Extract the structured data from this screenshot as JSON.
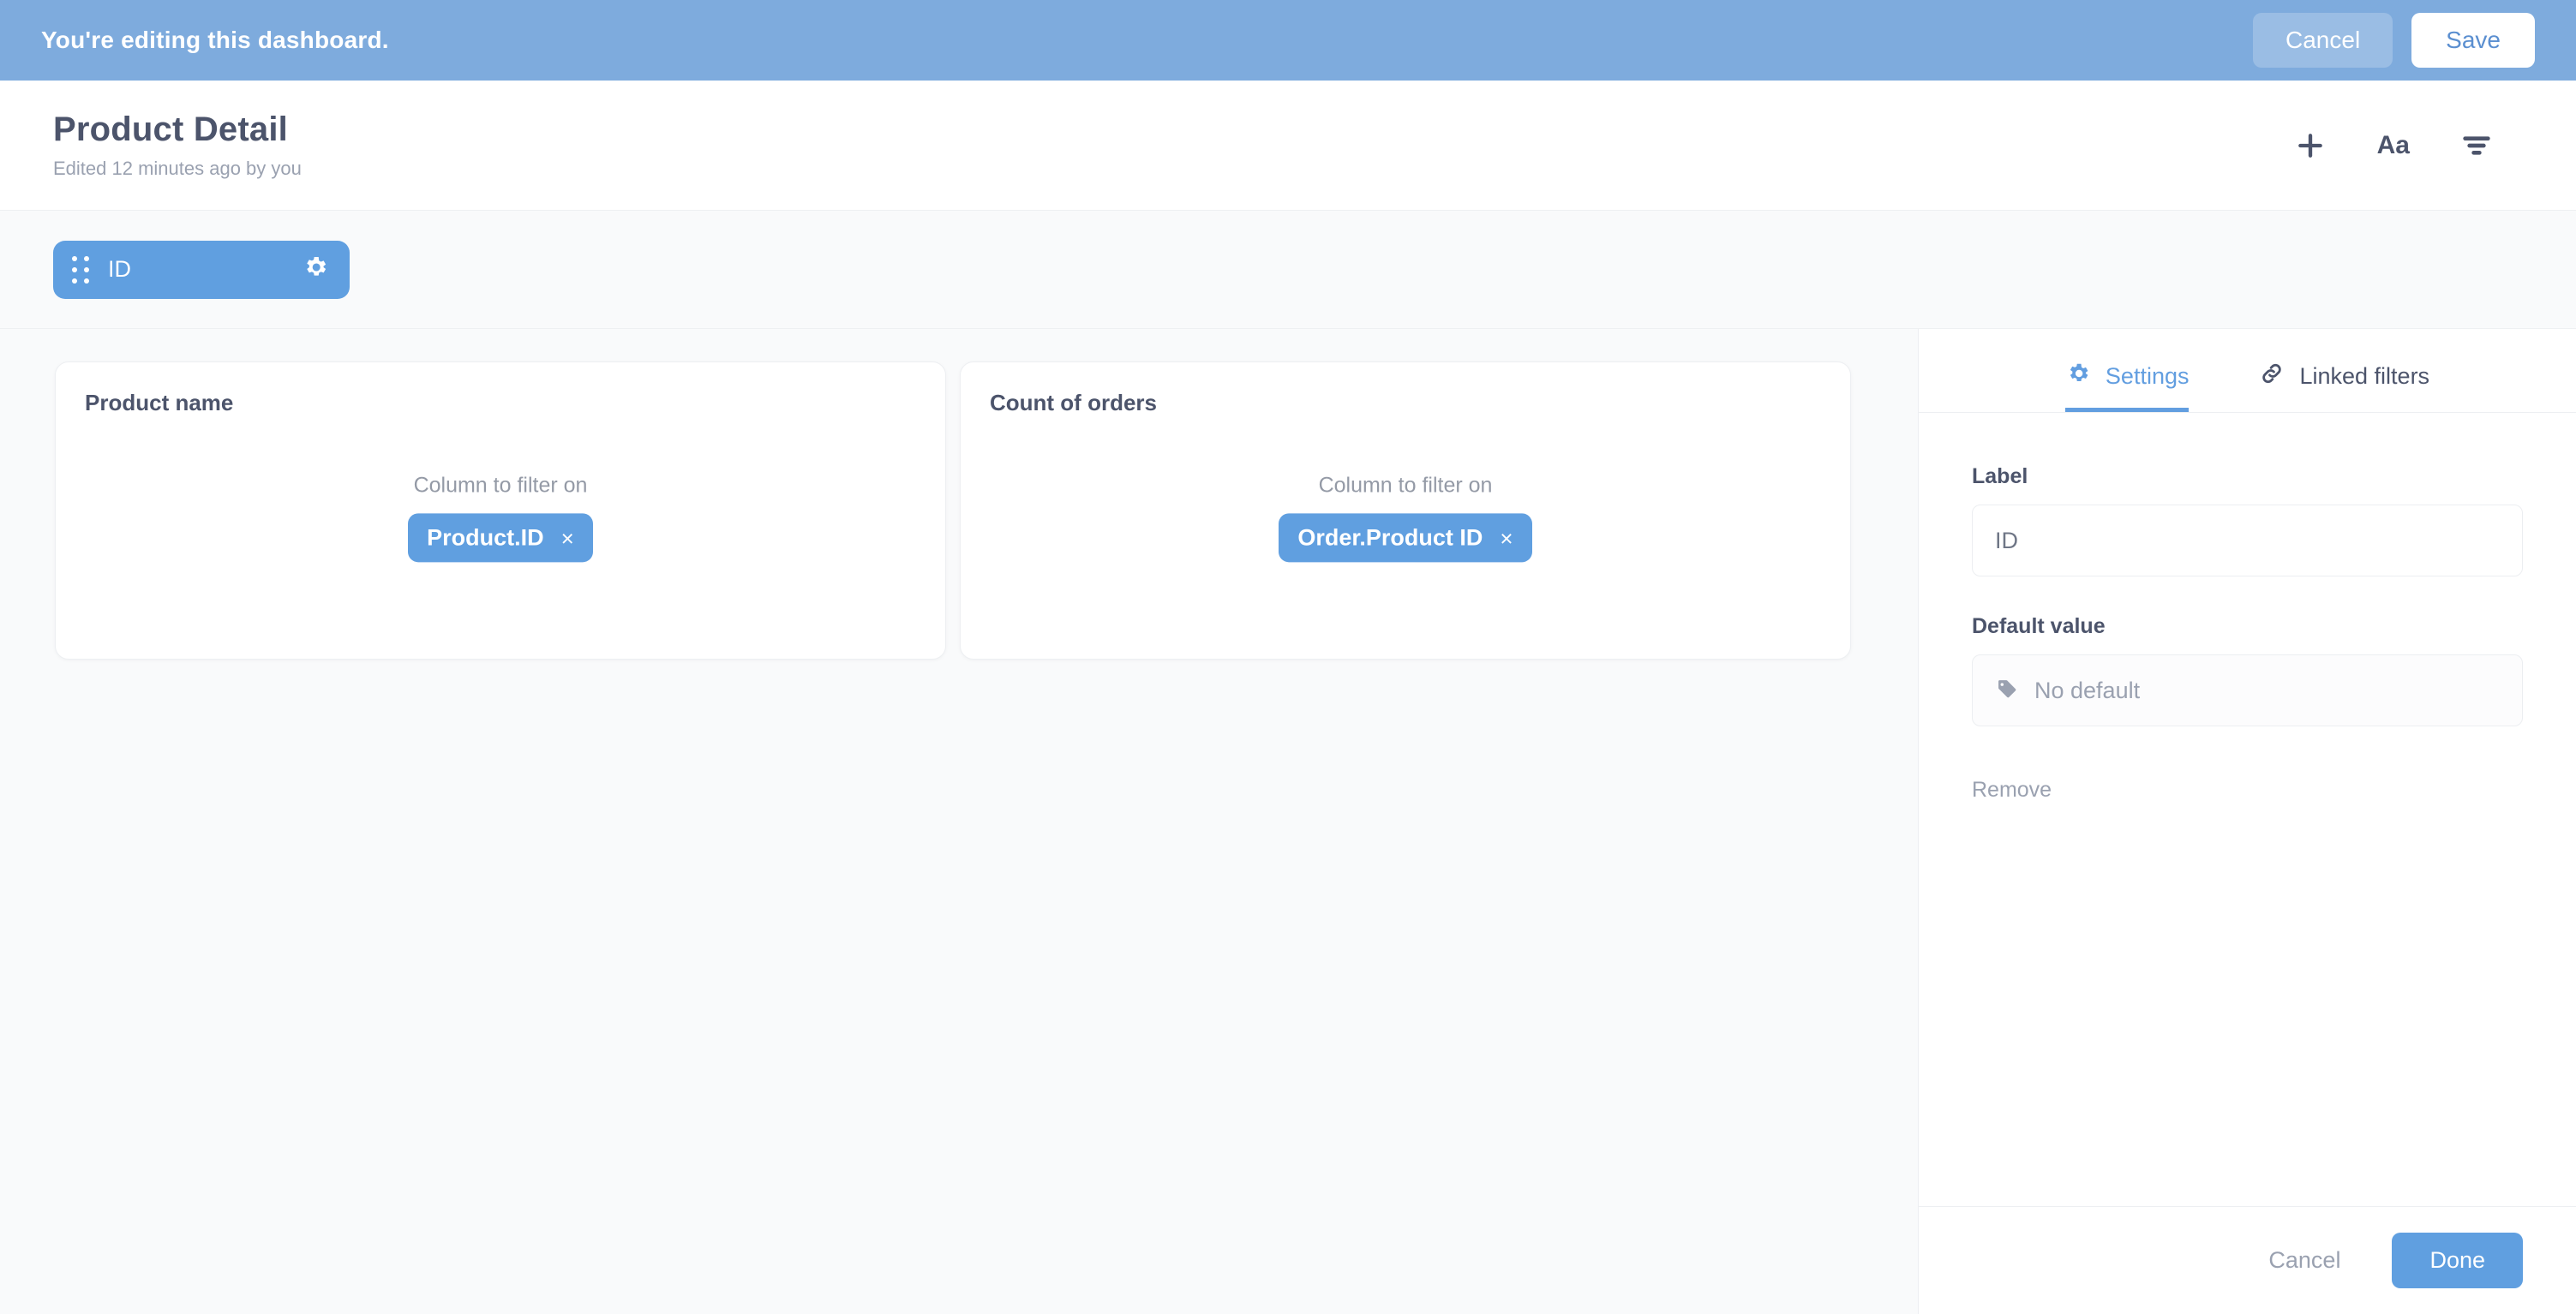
{
  "edit_banner": {
    "message": "You're editing this dashboard.",
    "cancel_label": "Cancel",
    "save_label": "Save",
    "background_color": "#7eabdd"
  },
  "header": {
    "title": "Product Detail",
    "subtitle": "Edited 12 minutes ago by you",
    "icons": [
      {
        "name": "plus-icon",
        "glyph": "+"
      },
      {
        "name": "text-icon",
        "glyph": "Aa"
      },
      {
        "name": "filter-icon",
        "glyph": "filter"
      }
    ]
  },
  "filter_bar": {
    "pills": [
      {
        "label": "ID",
        "drag_handle": "grip-icon",
        "settings_icon": "gear-icon",
        "color": "#609fe0",
        "selected": true
      }
    ]
  },
  "canvas": {
    "cards": [
      {
        "title": "Product name",
        "column_label": "Column to filter on",
        "column_pill": "Product.ID",
        "remove_glyph": "×"
      },
      {
        "title": "Count of orders",
        "column_label": "Column to filter on",
        "column_pill": "Order.Product ID",
        "remove_glyph": "×"
      }
    ]
  },
  "sidebar": {
    "tabs": [
      {
        "label": "Settings",
        "icon": "gear-icon",
        "active": true
      },
      {
        "label": "Linked filters",
        "icon": "link-icon",
        "active": false
      }
    ],
    "fields": {
      "label_field": {
        "label": "Label",
        "value": "ID"
      },
      "default_field": {
        "label": "Default value",
        "placeholder": "No default",
        "icon": "tag-icon"
      }
    },
    "remove_label": "Remove",
    "footer": {
      "cancel_label": "Cancel",
      "done_label": "Done"
    }
  },
  "theme": {
    "accent": "#609fe0",
    "banner": "#7eabdd",
    "text_dark": "#4c546b",
    "text_muted": "#9aa1b0",
    "canvas_bg": "#f9fafb"
  }
}
